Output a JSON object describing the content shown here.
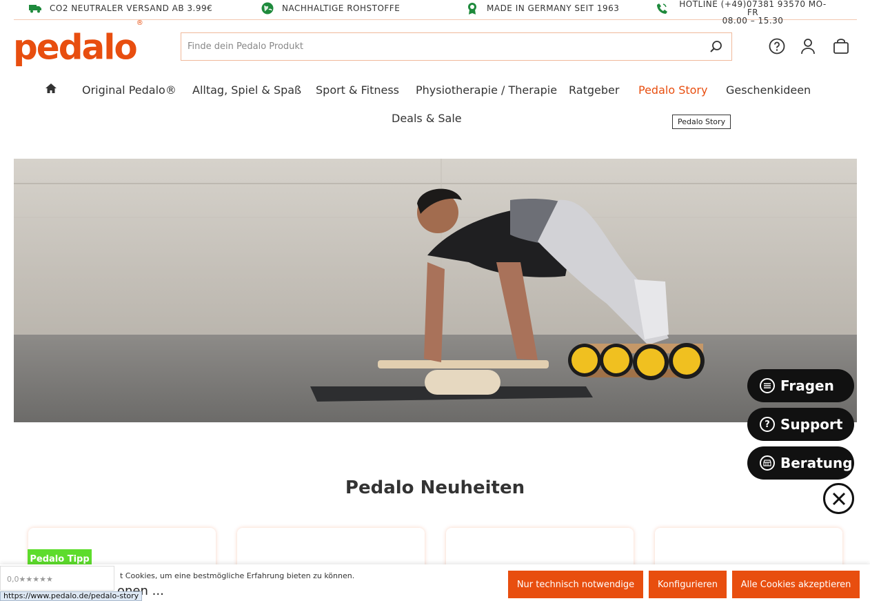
{
  "usp": [
    {
      "icon": "truck-icon",
      "text": "CO2 NEUTRALER VERSAND AB 3.99€"
    },
    {
      "icon": "globe-icon",
      "text": "NACHHALTIGE ROHSTOFFE"
    },
    {
      "icon": "award-icon",
      "text": "MADE IN GERMANY SEIT 1963"
    }
  ],
  "hotline": {
    "icon": "phone-icon",
    "line1": "HOTLINE (+49)07381 93570 MO-FR",
    "line2": "08.00 – 15.30"
  },
  "logo": {
    "text": "pedalo",
    "mark": "®"
  },
  "search": {
    "placeholder": "Finde dein Pedalo Produkt",
    "icon": "search-icon"
  },
  "header_icons": [
    "help-icon",
    "account-icon",
    "cart-icon"
  ],
  "nav": {
    "home_icon": "home-icon",
    "items": [
      "Original Pedalo®",
      "Alltag, Spiel & Spaß",
      "Sport & Fitness",
      "Physiotherapie / Therapie",
      "Ratgeber",
      "Pedalo Story",
      "Geschenkideen",
      "Deals & Sale"
    ],
    "active": "Pedalo Story",
    "tooltip": "Pedalo Story"
  },
  "section": {
    "title": "Pedalo Neuheiten"
  },
  "product": {
    "badge": "Pedalo Tipp"
  },
  "chat": {
    "buttons": [
      {
        "label": "Fragen",
        "icon": "list-icon"
      },
      {
        "label": "Support",
        "icon": "question-icon"
      },
      {
        "label": "Beratung",
        "icon": "store-icon"
      }
    ],
    "close_icon": "close-icon"
  },
  "cookie": {
    "text": "t Cookies, um eine bestmögliche Erfahrung bieten zu können.",
    "behind_text": "onen ...",
    "buttons": [
      "Nur technisch notwendige",
      "Konfigurieren",
      "Alle Cookies akzeptieren"
    ]
  },
  "rating": {
    "text": "0,0★★★★★"
  },
  "status_url": "https://www.pedalo.de/pedalo-story",
  "colors": {
    "brand": "#e84e0f",
    "usp_icon": "#1e8a3c",
    "badge": "#5ddc2c",
    "chat": "#111111"
  }
}
